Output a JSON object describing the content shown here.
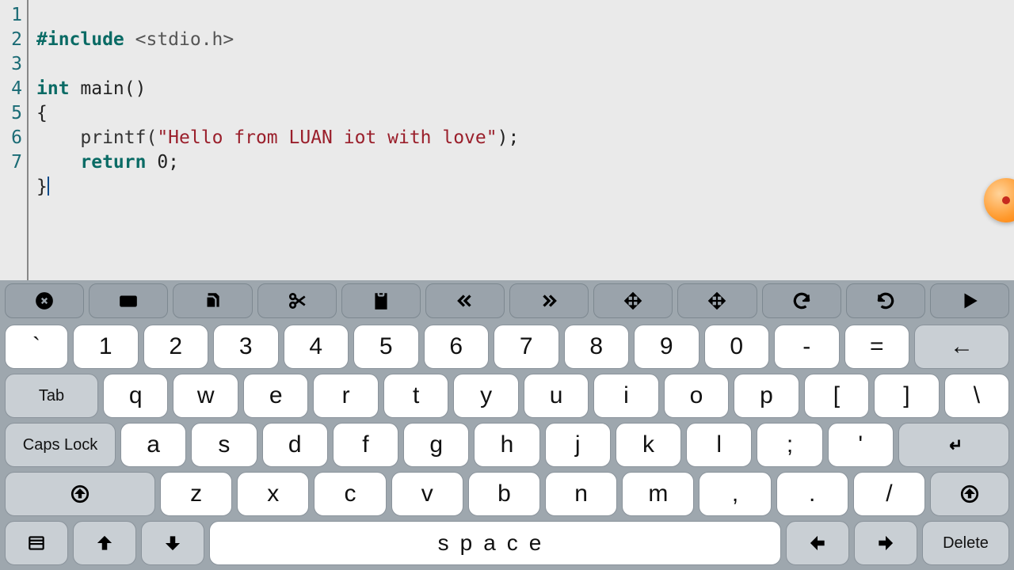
{
  "editor": {
    "line_numbers": [
      "1",
      "2",
      "3",
      "4",
      "5",
      "6",
      "7"
    ],
    "code": {
      "l1_pre": "#include",
      "l1_hdr": " <stdio.h>",
      "l3_kw": "int",
      "l3_rest": " main()",
      "l4": "{",
      "l5_indent": "    ",
      "l5_fn": "printf(",
      "l5_str": "\"Hello from LUAN iot with love\"",
      "l5_end": ");",
      "l6_indent": "    ",
      "l6_kw": "return",
      "l6_rest": " 0;",
      "l7": "}"
    }
  },
  "toolbar_icons": [
    "close-circle",
    "keyboard",
    "copy",
    "cut",
    "paste",
    "rewind",
    "fast-forward",
    "move",
    "move-alt",
    "undo",
    "redo",
    "play"
  ],
  "keyboard": {
    "row1": [
      "`",
      "1",
      "2",
      "3",
      "4",
      "5",
      "6",
      "7",
      "8",
      "9",
      "0",
      "-",
      "="
    ],
    "row1_backspace_glyph": "←",
    "row2_tab": "Tab",
    "row2": [
      "q",
      "w",
      "e",
      "r",
      "t",
      "y",
      "u",
      "i",
      "o",
      "p",
      "[",
      "]",
      "\\"
    ],
    "row3_caps": "Caps Lock",
    "row3": [
      "a",
      "s",
      "d",
      "f",
      "g",
      "h",
      "j",
      "k",
      "l",
      ";",
      "'"
    ],
    "row4": [
      "z",
      "x",
      "c",
      "v",
      "b",
      "n",
      "m",
      ",",
      ".",
      "/"
    ],
    "row5_space": "space",
    "row5_delete": "Delete"
  }
}
